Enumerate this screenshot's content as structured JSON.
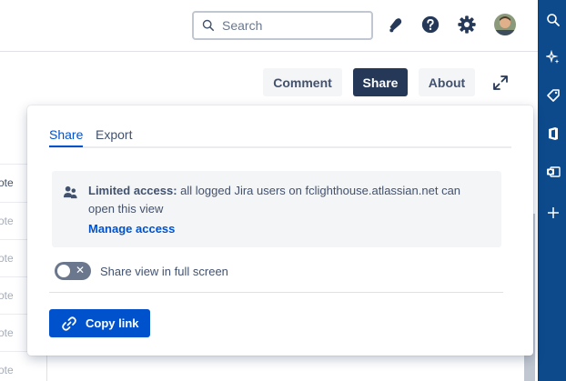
{
  "header": {
    "search_placeholder": "Search"
  },
  "toolbar": {
    "comment_label": "Comment",
    "share_label": "Share",
    "about_label": "About"
  },
  "background_table": {
    "header_cell": "ote",
    "cells": [
      "ote",
      "ote",
      "ote",
      "ote",
      "ote"
    ]
  },
  "share_popup": {
    "tabs": [
      {
        "label": "Share",
        "active": true
      },
      {
        "label": "Export",
        "active": false
      }
    ],
    "access_info": {
      "title": "Limited access:",
      "description": "all logged Jira users on fclighthouse.atlassian.net can open this view",
      "manage_link": "Manage access"
    },
    "fullscreen_toggle": {
      "label": "Share view in full screen",
      "checked": false
    },
    "copy_button": "Copy link"
  },
  "colors": {
    "primary_blue": "#0052cc",
    "dark_button": "#253858",
    "sidebar": "#0c4a8c",
    "light_button": "#f4f5f7"
  },
  "icons": [
    "search-icon",
    "notification-icon",
    "help-icon",
    "settings-icon",
    "avatar",
    "expand-icon",
    "people-icon",
    "link-icon"
  ]
}
